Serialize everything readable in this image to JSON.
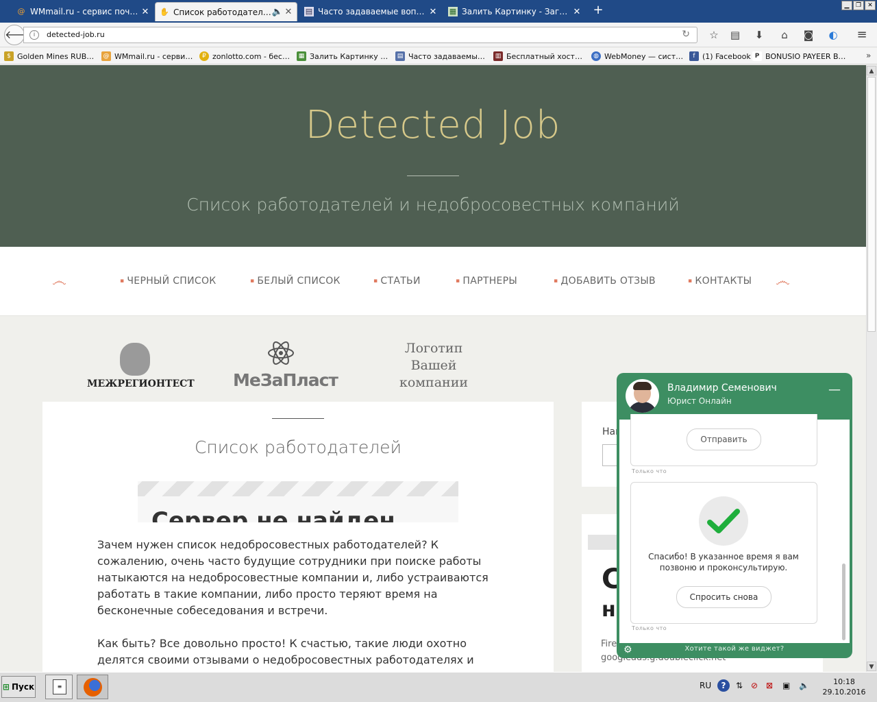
{
  "browser": {
    "tabs": [
      {
        "title": "WMmail.ru - сервис почтовы...",
        "icon": "at-sign-icon"
      },
      {
        "title": "Список работодателей",
        "icon": "hand-icon",
        "active": true
      },
      {
        "title": "Часто задаваемые вопросы...",
        "icon": "document-icon"
      },
      {
        "title": "Залить Картинку - Загрузи...",
        "icon": "image-icon"
      }
    ],
    "url": "detected-job.ru",
    "bookmarks": [
      {
        "label": "Golden Mines RUB - A...",
        "color": "#c9a227"
      },
      {
        "label": "WMmail.ru - сервис п...",
        "color": "#e8a33d"
      },
      {
        "label": "zonlotto.com - беспл...",
        "color": "#e2b10f"
      },
      {
        "label": "Залить Картинку - З...",
        "color": "#4a8f3a"
      },
      {
        "label": "Часто задаваемые в...",
        "color": "#5570a8"
      },
      {
        "label": "Бесплатный хостинг...",
        "color": "#7a2a2a"
      },
      {
        "label": "WebMoney — систем...",
        "color": "#3c6fc4"
      },
      {
        "label": "(1) Facebook",
        "color": "#3b5998"
      },
      {
        "label": "BONUSIO PAYEER BO...",
        "color": "#555555"
      }
    ]
  },
  "site": {
    "title": "Detected Job",
    "tagline": "Список работодателей и недобросовестных компаний",
    "menu": [
      "ЧЕРНЫЙ СПИСОК",
      "БЕЛЫЙ СПИСОК",
      "СТАТЬИ",
      "ПАРТНЕРЫ",
      "ДОБАВИТЬ ОТЗЫВ",
      "КОНТАКТЫ"
    ],
    "partners": {
      "p1": "МЕЖРЕГИОНТЕСТ",
      "p2": "МеЗаПласт",
      "p3": "Логотип Вашей компании"
    },
    "main": {
      "heading": "Список работодателей",
      "error_title": "Сервер не найден",
      "paragraph1": "Зачем нужен список недобросовестных работодателей? К сожалению, очень часто будущие сотрудники при поиске работы натыкаются на недобросовестные компании и, либо устраиваются работать в такие компании, либо просто теряют время на бесконечные собеседования и встречи.",
      "paragraph2": "Как быть? Все довольно просто! К счастью, такие люди охотно делятся своими отзывами о недобросовестных работодателях и предостерегают"
    },
    "sidebar": {
      "search_label": "Най",
      "big1": "С",
      "big2": "н",
      "small": "Fire googleads.g.doubleclick.net"
    }
  },
  "chat": {
    "agent_name": "Владимир Семенович",
    "agent_role": "Юрист Онлайн",
    "send_button": "Отправить",
    "time1": "Только что",
    "thanks_message": "Спасибо! В указанное время я вам позвоню и проконсультирую.",
    "ask_again_button": "Спросить снова",
    "time2": "Только что",
    "footer": "Хотите такой же виджет?",
    "accent_color": "#3d8e62"
  },
  "taskbar": {
    "start": "Пуск",
    "language": "RU",
    "time": "10:18",
    "date": "29.10.2016"
  }
}
